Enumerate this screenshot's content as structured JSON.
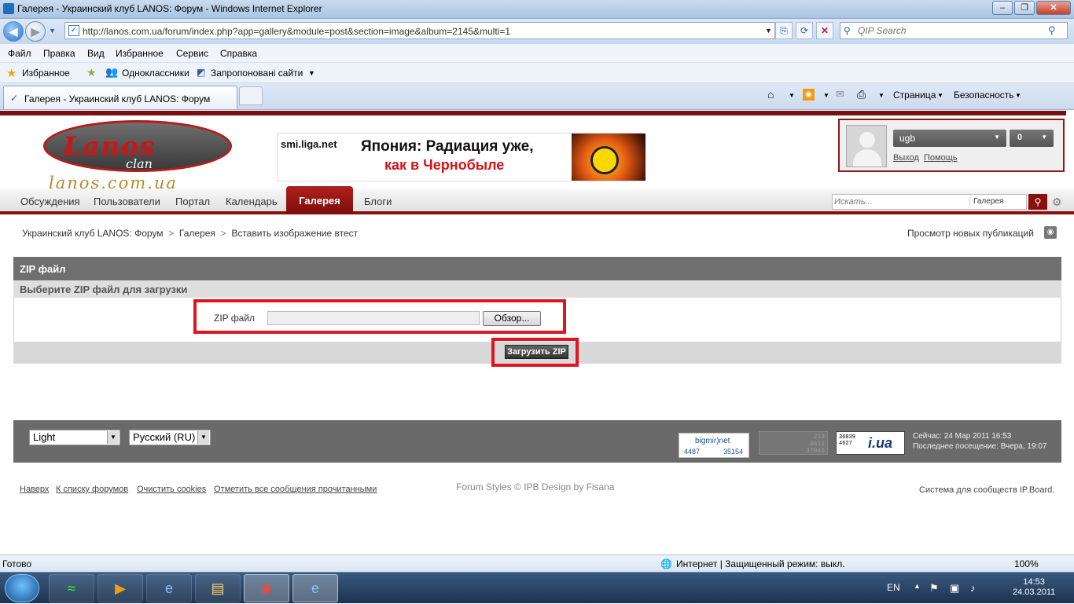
{
  "window": {
    "title": "Галерея - Украинский клуб LANOS: Форум - Windows Internet Explorer",
    "url": "http://lanos.com.ua/forum/index.php?app=gallery&module=post&section=image&album=2145&multi=1",
    "search_placeholder": "QIP Search"
  },
  "menu": [
    "Файл",
    "Правка",
    "Вид",
    "Избранное",
    "Сервис",
    "Справка"
  ],
  "favorites": {
    "label": "Избранное",
    "items": [
      "Одноклассники",
      "Запропоновані сайти"
    ]
  },
  "tab": {
    "title": "Галерея - Украинский клуб LANOS: Форум"
  },
  "toolbar": {
    "page": "Страница",
    "security": "Безопасность"
  },
  "header": {
    "logo_text": "Lanos",
    "logo_sub": "clan",
    "logo_url": "lanos.com.ua",
    "banner": {
      "source": "smi.liga.net",
      "line1": "Япония: Радиация уже,",
      "line2": "как в Чернобыле"
    },
    "user": {
      "name": "ugb",
      "count": "0",
      "logout": "Выход",
      "help": "Помощь"
    }
  },
  "nav": {
    "items": [
      "Обсуждения",
      "Пользователи",
      "Портал",
      "Календарь"
    ],
    "active": "Галерея",
    "after": [
      "Блоги"
    ],
    "search_placeholder": "Искать...",
    "search_scope": "Галерея"
  },
  "breadcrumb": {
    "items": [
      "Украинский клуб LANOS: Форум",
      "Галерея",
      "Вставить изображение втест"
    ],
    "new_posts": "Просмотр новых публикаций"
  },
  "form": {
    "title": "ZIP файл",
    "subtitle": "Выберите ZIP файл для загрузки",
    "field_label": "ZIP файл",
    "browse": "Обзор...",
    "submit": "Загрузить ZIP"
  },
  "footer": {
    "skin": "Light",
    "language": "Русский (RU)",
    "counter1": {
      "title": "bigmir)net",
      "a": "4487",
      "b": "35154"
    },
    "counter2": [
      "233",
      "4611",
      "37046"
    ],
    "counter3": {
      "left1": "36839",
      "left2": "4627",
      "right": "i.ua"
    },
    "info": {
      "now": "Сейчас: 24 Мар 2011 16:53",
      "last": "Последнее посещение: Вчера, 19:07"
    },
    "links": [
      "Наверх",
      "К списку форумов",
      "Очистить cookies",
      "Отметить все сообщения прочитанными"
    ],
    "styles": "Forum Styles © IPB Design by Fisana",
    "powered": "Система для сообществ IP.Board."
  },
  "status": {
    "left": "Готово",
    "zone": "Интернет | Защищенный режим: выкл.",
    "zoom": "100%"
  },
  "taskbar": {
    "lang": "EN",
    "time": "14:53",
    "date": "24.03.2011"
  },
  "colors": {
    "accent": "#8b0e0e",
    "highlight": "#e0141e"
  }
}
